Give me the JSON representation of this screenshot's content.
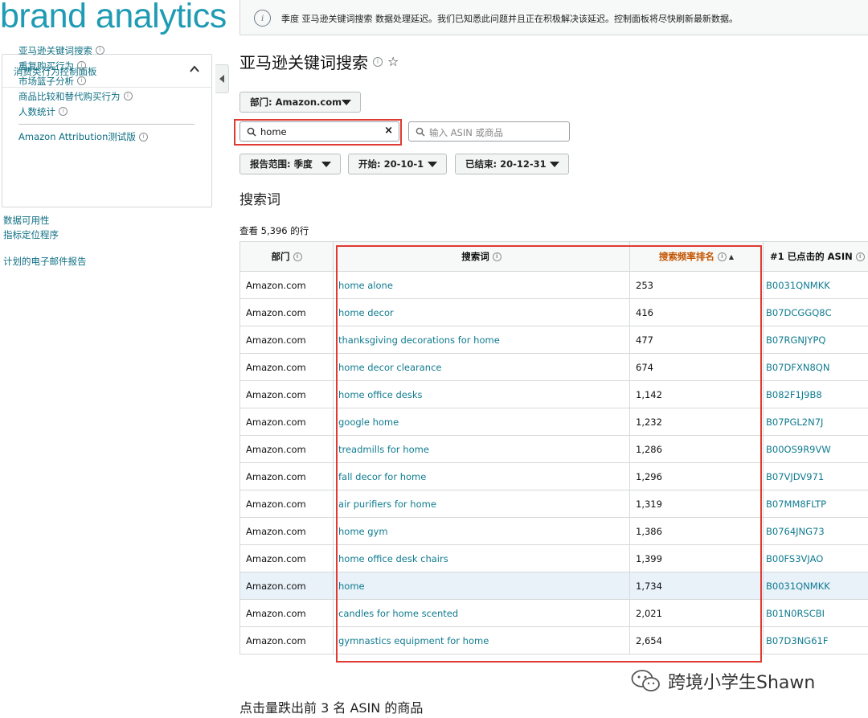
{
  "brand": "brand analytics",
  "sidebar": {
    "title": "消费类行为控制面板",
    "items": [
      {
        "label": "亚马逊关键词搜索"
      },
      {
        "label": "重复购买行为"
      },
      {
        "label": "市场篮子分析"
      },
      {
        "label": "商品比较和替代购买行为"
      },
      {
        "label": "人数统计"
      }
    ],
    "attribution": "Amazon Attribution测试版"
  },
  "extra_links": [
    "数据可用性",
    "指标定位程序",
    "计划的电子邮件报告"
  ],
  "notice": "季度 亚马逊关键词搜索 数据处理延迟。我们已知悉此问题并且正在积极解决该延迟。控制面板将尽快刷新最新数据。",
  "page_title": "亚马逊关键词搜索",
  "filters": {
    "department": "部门: Amazon.com",
    "search_value": "home",
    "asin_placeholder": "输入 ASIN 或商品",
    "report_range": "报告范围: 季度",
    "start": "开始: 20-10-1",
    "end": "已结束: 20-12-31"
  },
  "section_title": "搜索词",
  "rows_count": "查看 5,396 的行",
  "table": {
    "headers": {
      "department": "部门",
      "term": "搜索词",
      "rank": "搜索频率排名",
      "asin": "#1 已点击的 ASIN"
    },
    "rows": [
      {
        "dept": "Amazon.com",
        "term": "home alone",
        "rank": "253",
        "asin": "B0031QNMKK"
      },
      {
        "dept": "Amazon.com",
        "term": "home decor",
        "rank": "416",
        "asin": "B07DCGGQ8C"
      },
      {
        "dept": "Amazon.com",
        "term": "thanksgiving decorations for home",
        "rank": "477",
        "asin": "B07RGNJYPQ"
      },
      {
        "dept": "Amazon.com",
        "term": "home decor clearance",
        "rank": "674",
        "asin": "B07DFXN8QN"
      },
      {
        "dept": "Amazon.com",
        "term": "home office desks",
        "rank": "1,142",
        "asin": "B082F1J9B8"
      },
      {
        "dept": "Amazon.com",
        "term": "google home",
        "rank": "1,232",
        "asin": "B07PGL2N7J"
      },
      {
        "dept": "Amazon.com",
        "term": "treadmills for home",
        "rank": "1,286",
        "asin": "B00OS9R9VW"
      },
      {
        "dept": "Amazon.com",
        "term": "fall decor for home",
        "rank": "1,296",
        "asin": "B07VJDV971"
      },
      {
        "dept": "Amazon.com",
        "term": "air purifiers for home",
        "rank": "1,319",
        "asin": "B07MM8FLTP"
      },
      {
        "dept": "Amazon.com",
        "term": "home gym",
        "rank": "1,386",
        "asin": "B0764JNG73"
      },
      {
        "dept": "Amazon.com",
        "term": "home office desk chairs",
        "rank": "1,399",
        "asin": "B00FS3VJAO"
      },
      {
        "dept": "Amazon.com",
        "term": "home",
        "rank": "1,734",
        "asin": "B0031QNMKK"
      },
      {
        "dept": "Amazon.com",
        "term": "candles for home scented",
        "rank": "2,021",
        "asin": "B01N0RSCBI"
      },
      {
        "dept": "Amazon.com",
        "term": "gymnastics equipment for home",
        "rank": "2,654",
        "asin": "B07D3NG61F"
      }
    ]
  },
  "bottom_section_title": "点击量跌出前 3 名 ASIN 的商品",
  "watermark": "跨境小学生Shawn",
  "colors": {
    "link": "#0f7b8f",
    "accent_sort": "#c45500",
    "highlight_box": "#e03a33",
    "logo": "#1f9bb4"
  },
  "icons": [
    "info-icon",
    "star-icon",
    "search-icon",
    "clear-icon",
    "chevron-up-icon",
    "collapse-arrow-icon",
    "caret-down-icon",
    "sort-asc-icon",
    "wechat-icon"
  ]
}
